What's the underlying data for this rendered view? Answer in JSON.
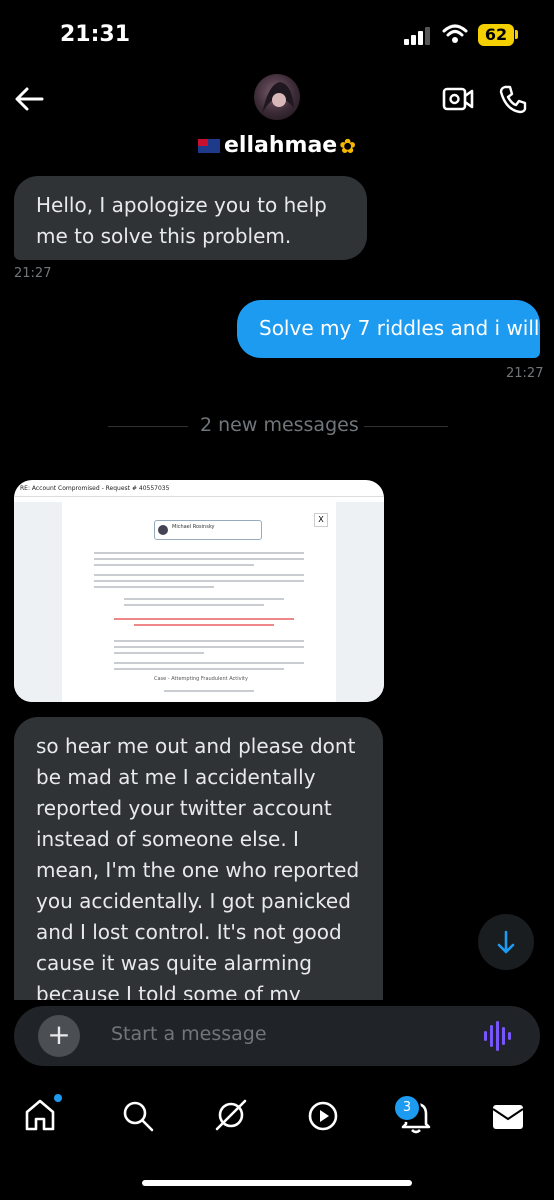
{
  "status_bar": {
    "time": "21:31",
    "battery": "62"
  },
  "header": {
    "username": "ellahmae",
    "back_icon": "arrow-left-icon",
    "video_icon": "video-call-icon",
    "phone_icon": "phone-call-icon"
  },
  "messages": [
    {
      "direction": "incoming",
      "text": "Hello, I apologize you to help me to solve this problem.",
      "timestamp": "21:27"
    },
    {
      "direction": "outgoing",
      "text": "Solve my 7 riddles and i will",
      "timestamp": "21:27"
    }
  ],
  "new_messages_divider": "2 new messages",
  "image_message": {
    "title": "RE: Account Compromised - Request # 40557035",
    "card_name": "Michael Rosinsky",
    "footer_case": "Case - Attempting Fraudulent Activity"
  },
  "long_message": {
    "text": "so hear me out and please dont be mad at me I accidentally reported your twitter account instead of someone else. I mean, I'm the one who reported you accidentally. I got panicked and I lost control. It's not good cause it was quite alarming because I told some of my friends to report you. That's why I reached out to you to"
  },
  "composer": {
    "placeholder": "Start a message"
  },
  "bottom_nav": {
    "items": [
      "home",
      "search",
      "grok",
      "video",
      "notifications",
      "messages"
    ],
    "notification_count": "3"
  },
  "colors": {
    "accent": "#1d9bf0",
    "incoming_bubble": "#2f3336",
    "battery": "#f5d000"
  }
}
